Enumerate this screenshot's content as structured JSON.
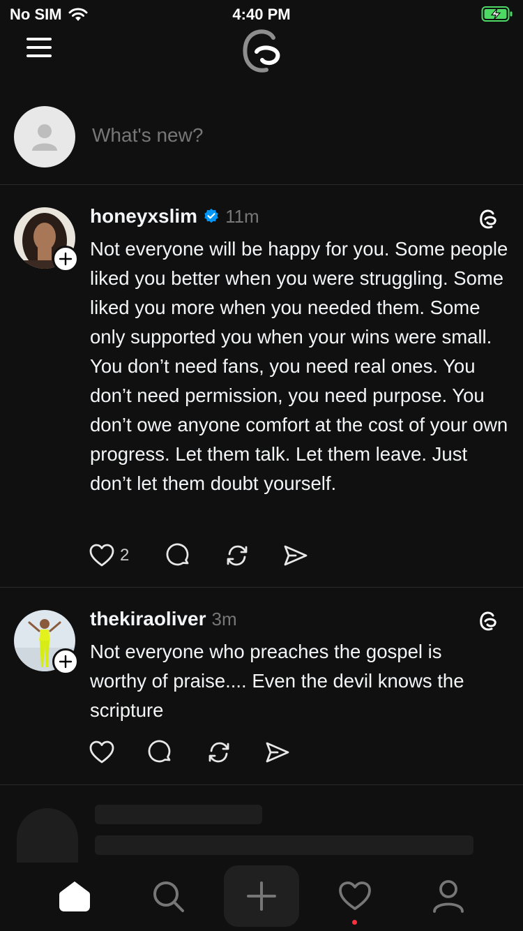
{
  "status_bar": {
    "carrier": "No SIM",
    "time": "4:40 PM"
  },
  "composer": {
    "placeholder": "What's new?"
  },
  "posts": [
    {
      "username": "honeyxslim",
      "verified": true,
      "time": "11m",
      "text": "Not everyone will be happy for you. Some people liked you better when you were struggling. Some liked you more when you needed them. Some only supported you when your wins were small. You don’t need fans, you need real ones. You don’t need permission, you need purpose. You don’t owe anyone comfort at the cost of your own progress. Let them talk. Let them leave. Just don’t let them doubt yourself.",
      "like_count": "2"
    },
    {
      "username": "thekiraoliver",
      "verified": false,
      "time": "3m",
      "text": "Not everyone who preaches the gospel is worthy of praise.... Even the devil knows the scripture",
      "like_count": ""
    }
  ],
  "icons": {
    "menu": "menu-icon",
    "logo": "threads-logo-icon",
    "like": "heart-icon",
    "reply": "comment-icon",
    "repost": "repost-icon",
    "share": "send-icon",
    "tabs": [
      "home-icon",
      "search-icon",
      "plus-icon",
      "heart-icon",
      "profile-icon"
    ]
  },
  "colors": {
    "background": "#101010",
    "verified": "#0095f6",
    "notification_dot": "#ff3040",
    "battery_charging": "#4cd964"
  }
}
